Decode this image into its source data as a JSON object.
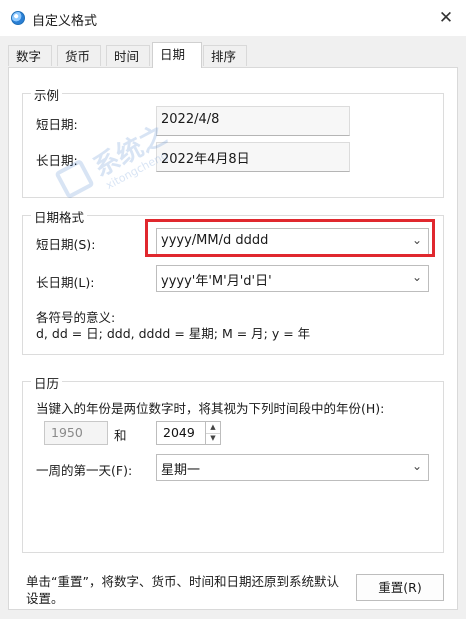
{
  "window": {
    "title": "自定义格式",
    "close_glyph": "✕"
  },
  "tabs": [
    {
      "label": "数字"
    },
    {
      "label": "货币"
    },
    {
      "label": "时间"
    },
    {
      "label": "日期",
      "active": true
    },
    {
      "label": "排序"
    }
  ],
  "sample": {
    "group_title": "示例",
    "short_label": "短日期:",
    "short_value": "2022/4/8",
    "long_label": "长日期:",
    "long_value": "2022年4月8日"
  },
  "format": {
    "group_title": "日期格式",
    "short_label": "短日期(S):",
    "short_value": "yyyy/MM/d dddd",
    "long_label": "长日期(L):",
    "long_value": "yyyy'年'M'月'd'日'",
    "legend_title": "各符号的意义:",
    "legend_text": "d, dd = 日;  ddd, dddd = 星期;  M = 月;  y = 年"
  },
  "calendar": {
    "group_title": "日历",
    "two_digit_text": "当键入的年份是两位数字时，将其视为下列时间段中的年份(H):",
    "from_year": "1950",
    "and_label": "和",
    "to_year": "2049",
    "first_day_label": "一周的第一天(F):",
    "first_day_value": "星期一"
  },
  "footer": {
    "reset_text": "单击“重置”，将数字、货币、时间和日期还原到系统默认设置。",
    "reset_button": "重置(R)"
  },
  "watermark": {
    "main": "系统之",
    "sub": "xitongcheng"
  },
  "accent_colors": {
    "highlight": "#e0282e",
    "watermark": "#3070c8"
  }
}
